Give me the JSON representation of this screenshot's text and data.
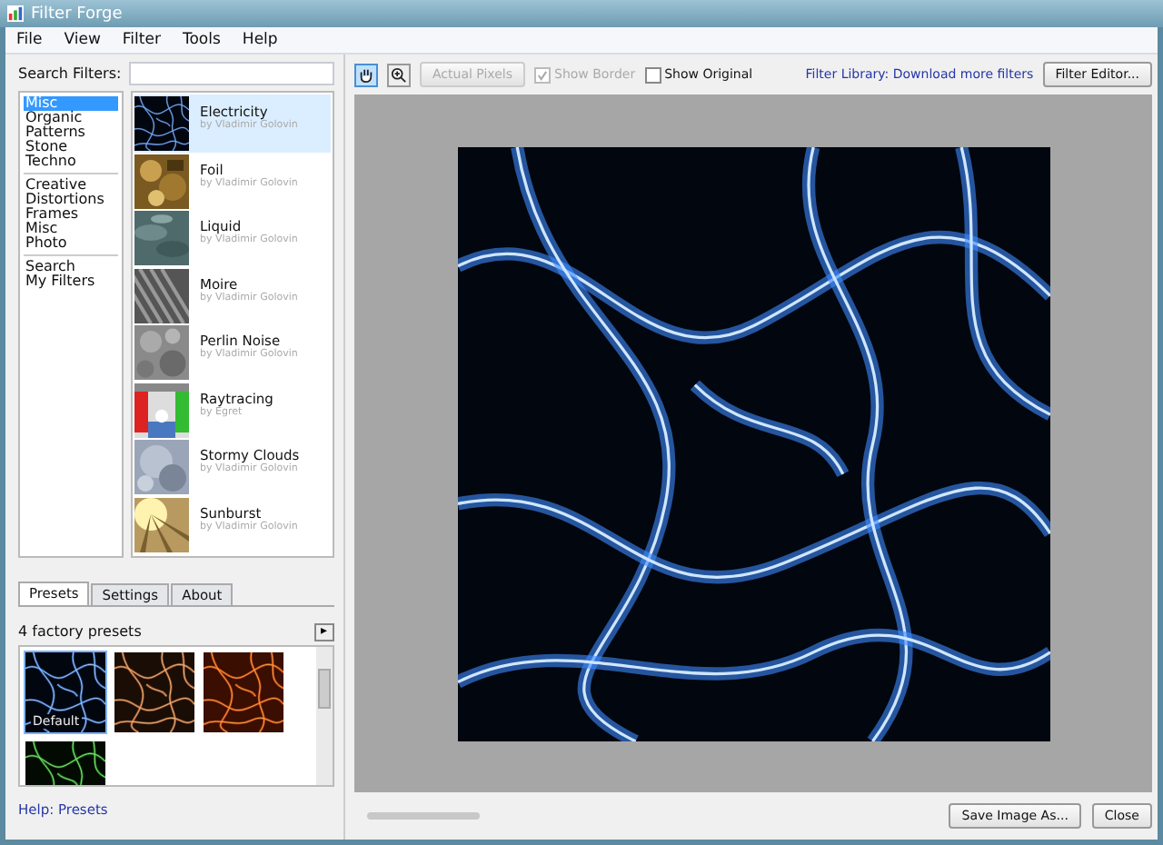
{
  "window": {
    "title": "Filter Forge"
  },
  "menu": [
    "File",
    "View",
    "Filter",
    "Tools",
    "Help"
  ],
  "search": {
    "label": "Search Filters:"
  },
  "category_groups": [
    {
      "items": [
        {
          "label": "Misc",
          "selected": true
        },
        {
          "label": "Organic",
          "selected": false
        },
        {
          "label": "Patterns",
          "selected": false
        },
        {
          "label": "Stone",
          "selected": false
        },
        {
          "label": "Techno",
          "selected": false
        }
      ]
    },
    {
      "items": [
        {
          "label": "Creative",
          "selected": false
        },
        {
          "label": "Distortions",
          "selected": false
        },
        {
          "label": "Frames",
          "selected": false
        },
        {
          "label": "Misc",
          "selected": false
        },
        {
          "label": "Photo",
          "selected": false
        }
      ]
    },
    {
      "items": [
        {
          "label": "Search",
          "selected": false
        },
        {
          "label": "My Filters",
          "selected": false
        }
      ]
    }
  ],
  "filters": [
    {
      "name": "Electricity",
      "author": "by Vladimir Golovin",
      "selected": true
    },
    {
      "name": "Foil",
      "author": "by Vladimir Golovin",
      "selected": false
    },
    {
      "name": "Liquid",
      "author": "by Vladimir Golovin",
      "selected": false
    },
    {
      "name": "Moire",
      "author": "by Vladimir Golovin",
      "selected": false
    },
    {
      "name": "Perlin Noise",
      "author": "by Vladimir Golovin",
      "selected": false
    },
    {
      "name": "Raytracing",
      "author": "by Egret",
      "selected": false
    },
    {
      "name": "Stormy Clouds",
      "author": "by Vladimir Golovin",
      "selected": false
    },
    {
      "name": "Sunburst",
      "author": "by Vladimir Golovin",
      "selected": false
    }
  ],
  "tabs": [
    {
      "label": "Presets",
      "selected": true
    },
    {
      "label": "Settings",
      "selected": false
    },
    {
      "label": "About",
      "selected": false
    }
  ],
  "presets": {
    "count_label": "4 factory presets",
    "next_button": "▸",
    "items": [
      {
        "label": "Default",
        "selected": true
      },
      {
        "selected": false
      },
      {
        "selected": false
      },
      {
        "selected": false
      }
    ]
  },
  "help_link": "Help: Presets",
  "progress": {
    "level": 0
  },
  "toolbar": {
    "hand_selected": true,
    "zoom_selected": false,
    "actual_pixels": {
      "label": "Actual Pixels",
      "disabled": true
    },
    "show_border": {
      "label": "Show Border",
      "checked": true,
      "disabled": true
    },
    "show_original": {
      "label": "Show Original",
      "checked": false,
      "disabled": false
    },
    "library_link": "Filter Library: Download more filters",
    "editor_button": "Filter Editor..."
  },
  "buttons": [
    "Save Image As...",
    "Close"
  ]
}
